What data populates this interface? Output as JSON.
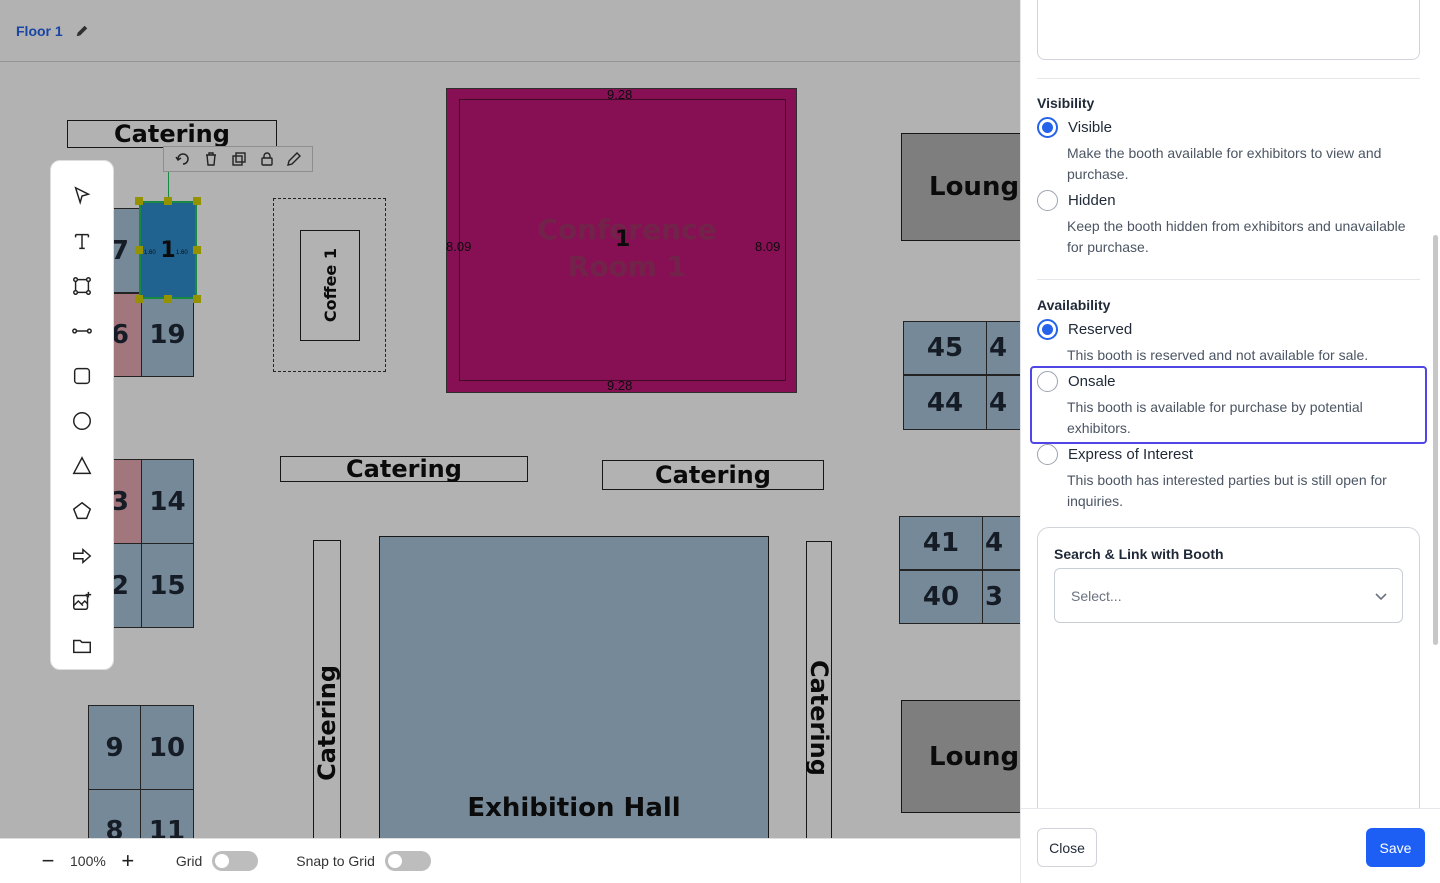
{
  "header": {
    "floor_name": "Floor 1"
  },
  "floorplan": {
    "catering_labels": [
      "Catering",
      "Catering",
      "Catering",
      "Catering",
      "Catering"
    ],
    "lounge_labels": [
      "Lounge",
      "Lounge"
    ],
    "coffee_label": "Coffee 1",
    "conference": {
      "label": "Conference Room 1",
      "booth_number": "1",
      "width_dim": "9.28",
      "height_dim": "8.09"
    },
    "exhibition_label": "Exhibition Hall",
    "selected_booth": {
      "number": "1",
      "left_dim": "1.60",
      "right_dim": "1.60"
    },
    "booths": {
      "b7": "7",
      "b6": "6",
      "b19": "19",
      "b3": "3",
      "b14": "14",
      "b2": "2",
      "b15": "15",
      "b9": "9",
      "b10": "10",
      "b8": "8",
      "b11": "11",
      "b45": "45",
      "b44": "44",
      "b41": "41",
      "b40": "40",
      "b45b": "4",
      "b44b": "4",
      "b41b": "4",
      "b40b": "3"
    },
    "colors": {
      "conference": "#c2187a",
      "selected": "#2f8fd0",
      "booth": "#a8c4dc",
      "pink_booth": "#e7a9b3"
    }
  },
  "toolbar": {
    "tools": [
      "select-arrow-icon",
      "text-icon",
      "polygon-nodes-icon",
      "line-icon",
      "rectangle-icon",
      "circle-icon",
      "triangle-icon",
      "pentagon-icon",
      "arrow-right-icon",
      "image-add-icon",
      "folder-icon"
    ]
  },
  "bottombar": {
    "zoom": "100%",
    "grid_label": "Grid",
    "snap_label": "Snap to Grid"
  },
  "panel": {
    "visibility": {
      "title": "Visibility",
      "options": [
        {
          "label": "Visible",
          "desc": "Make the booth available for exhibitors to view and purchase.",
          "checked": true
        },
        {
          "label": "Hidden",
          "desc": "Keep the booth hidden from exhibitors and unavailable for purchase.",
          "checked": false
        }
      ]
    },
    "availability": {
      "title": "Availability",
      "options": [
        {
          "label": "Reserved",
          "desc": "This booth is reserved and not available for sale.",
          "checked": true
        },
        {
          "label": "Onsale",
          "desc": "This booth is available for purchase by potential exhibitors.",
          "checked": false
        },
        {
          "label": "Express of Interest",
          "desc": "This booth has interested parties but is still open for inquiries.",
          "checked": false
        }
      ]
    },
    "link": {
      "title": "Search & Link with Booth",
      "placeholder": "Select..."
    },
    "footer": {
      "close_label": "Close",
      "save_label": "Save"
    }
  }
}
